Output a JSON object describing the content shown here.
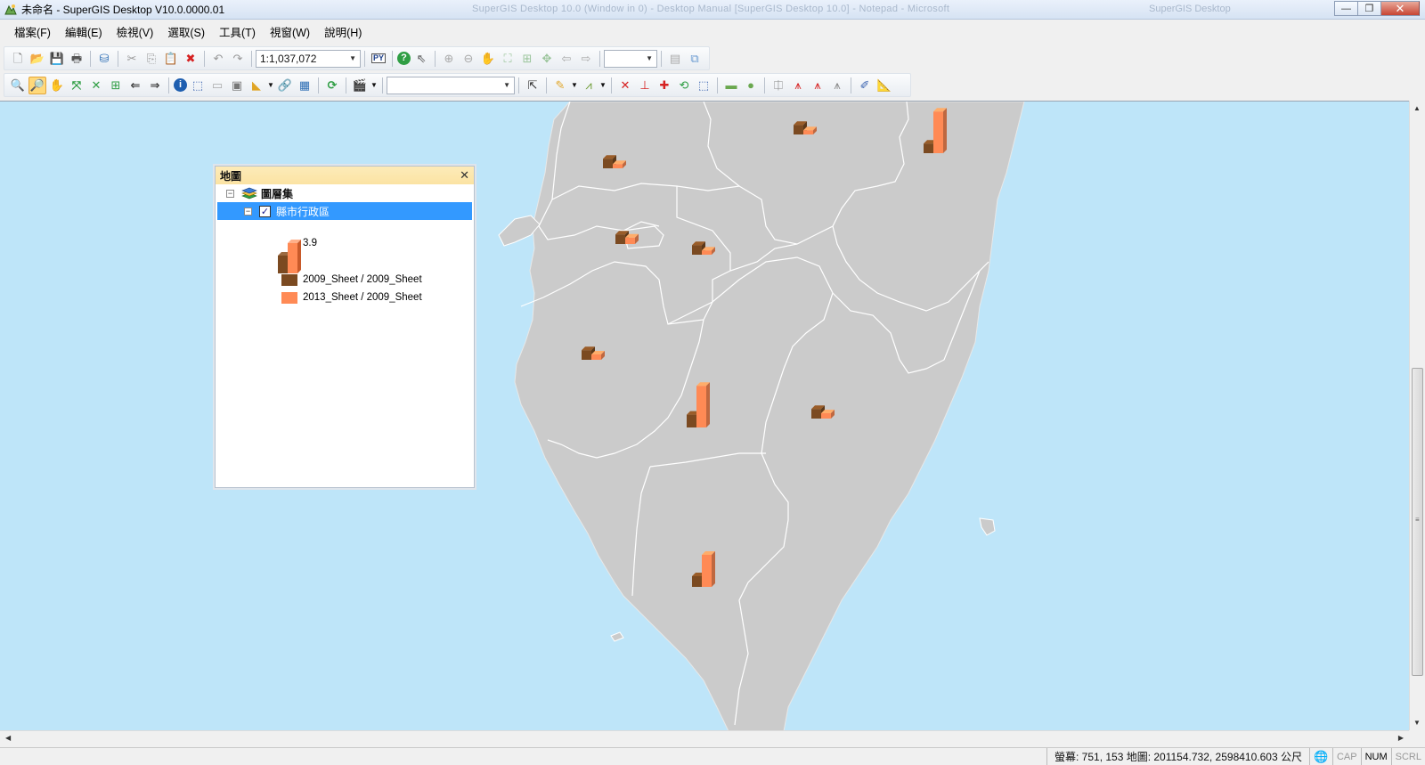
{
  "window": {
    "title": "未命名 - SuperGIS Desktop V10.0.0000.01",
    "ghost_title": "SuperGIS Desktop 10.0 (Window in 0) - Desktop Manual [SuperGIS Desktop 10.0] - Notepad - Microsoft",
    "ghost_right": "SuperGIS Desktop",
    "minimize": "—",
    "maximize": "❐",
    "close": "✕"
  },
  "menu": [
    "檔案(F)",
    "編輯(E)",
    "檢視(V)",
    "選取(S)",
    "工具(T)",
    "視窗(W)",
    "說明(H)"
  ],
  "toolbar": {
    "scale_value": "1:1,037,072",
    "py_label": "PY",
    "help_icon": "help-icon",
    "zoom_combo_value": "",
    "layer_combo_value": ""
  },
  "legend": {
    "title": "地圖",
    "close": "✕",
    "layer_set": "圖層集",
    "layer_name": "縣市行政區",
    "chart_max_label": "3.9",
    "items": [
      {
        "label": "2009_Sheet / 2009_Sheet",
        "color": "#7b4a21"
      },
      {
        "label": "2013_Sheet / 2009_Sheet",
        "color": "#ff8a55"
      }
    ]
  },
  "map": {
    "sea_color": "#bee5f9",
    "land_color": "#cbcbcb",
    "border_color": "#ffffff",
    "series_colors": {
      "s2009": "#7b4a21",
      "s2013": "#ff8a55"
    },
    "bar_charts": [
      {
        "region": "north-a",
        "v2009": 0.9,
        "v2013": 0.4
      },
      {
        "region": "north-b",
        "v2009": 0.9,
        "v2013": 0.4
      },
      {
        "region": "northeast",
        "v2009": 0.9,
        "v2013": 3.9
      },
      {
        "region": "central-a",
        "v2009": 0.9,
        "v2013": 0.6
      },
      {
        "region": "central-b",
        "v2009": 0.9,
        "v2013": 0.4
      },
      {
        "region": "west-central",
        "v2009": 0.9,
        "v2013": 0.5
      },
      {
        "region": "central-south",
        "v2009": 1.2,
        "v2013": 3.9
      },
      {
        "region": "east",
        "v2009": 0.9,
        "v2013": 0.5
      },
      {
        "region": "south",
        "v2009": 1.0,
        "v2013": 3.0
      }
    ]
  },
  "status": {
    "coords": "螢幕: 751, 153  地圖: 201154.732, 2598410.603 公尺",
    "cap": "CAP",
    "num": "NUM",
    "scrl": "SCRL"
  }
}
